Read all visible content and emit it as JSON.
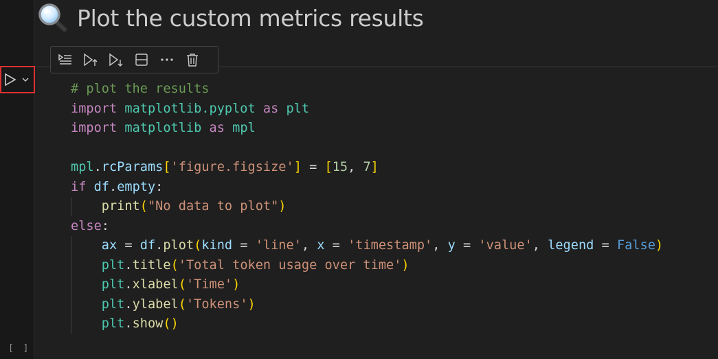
{
  "heading": {
    "icon": "magnifier-icon",
    "title": "Plot the custom metrics results"
  },
  "toolbar": {
    "items": [
      {
        "name": "run-by-line-icon"
      },
      {
        "name": "execute-above-icon"
      },
      {
        "name": "execute-below-icon"
      },
      {
        "name": "split-cell-icon"
      },
      {
        "name": "more-actions-icon"
      },
      {
        "name": "delete-cell-icon"
      }
    ]
  },
  "cell": {
    "execution_count": "[ ]",
    "run_icon": "play-icon",
    "code_lines": [
      [
        {
          "t": "# plot the results",
          "c": "com"
        }
      ],
      [
        {
          "t": "import",
          "c": "kw"
        },
        {
          "t": " ",
          "c": "def"
        },
        {
          "t": "matplotlib.pyplot",
          "c": "mod"
        },
        {
          "t": " ",
          "c": "def"
        },
        {
          "t": "as",
          "c": "kw"
        },
        {
          "t": " ",
          "c": "def"
        },
        {
          "t": "plt",
          "c": "mod"
        }
      ],
      [
        {
          "t": "import",
          "c": "kw"
        },
        {
          "t": " ",
          "c": "def"
        },
        {
          "t": "matplotlib",
          "c": "mod"
        },
        {
          "t": " ",
          "c": "def"
        },
        {
          "t": "as",
          "c": "kw"
        },
        {
          "t": " ",
          "c": "def"
        },
        {
          "t": "mpl",
          "c": "mod"
        }
      ],
      [],
      [
        {
          "t": "mpl",
          "c": "mod"
        },
        {
          "t": ".",
          "c": "def"
        },
        {
          "t": "rcParams",
          "c": "var"
        },
        {
          "t": "[",
          "c": "p1"
        },
        {
          "t": "'figure.figsize'",
          "c": "str"
        },
        {
          "t": "]",
          "c": "p1"
        },
        {
          "t": " = ",
          "c": "def"
        },
        {
          "t": "[",
          "c": "p1"
        },
        {
          "t": "15",
          "c": "num"
        },
        {
          "t": ", ",
          "c": "def"
        },
        {
          "t": "7",
          "c": "num"
        },
        {
          "t": "]",
          "c": "p1"
        }
      ],
      [
        {
          "t": "if",
          "c": "kw"
        },
        {
          "t": " ",
          "c": "def"
        },
        {
          "t": "df",
          "c": "var"
        },
        {
          "t": ".",
          "c": "def"
        },
        {
          "t": "empty",
          "c": "var"
        },
        {
          "t": ":",
          "c": "def"
        }
      ],
      [
        {
          "t": "    ",
          "c": "def"
        },
        {
          "t": "print",
          "c": "fn"
        },
        {
          "t": "(",
          "c": "p1"
        },
        {
          "t": "\"No data to plot\"",
          "c": "str"
        },
        {
          "t": ")",
          "c": "p1"
        }
      ],
      [
        {
          "t": "else",
          "c": "kw"
        },
        {
          "t": ":",
          "c": "def"
        }
      ],
      [
        {
          "t": "    ",
          "c": "def"
        },
        {
          "t": "ax",
          "c": "var"
        },
        {
          "t": " = ",
          "c": "def"
        },
        {
          "t": "df",
          "c": "var"
        },
        {
          "t": ".",
          "c": "def"
        },
        {
          "t": "plot",
          "c": "fn"
        },
        {
          "t": "(",
          "c": "p1"
        },
        {
          "t": "kind",
          "c": "var"
        },
        {
          "t": " = ",
          "c": "def"
        },
        {
          "t": "'line'",
          "c": "str"
        },
        {
          "t": ", ",
          "c": "def"
        },
        {
          "t": "x",
          "c": "var"
        },
        {
          "t": " = ",
          "c": "def"
        },
        {
          "t": "'timestamp'",
          "c": "str"
        },
        {
          "t": ", ",
          "c": "def"
        },
        {
          "t": "y",
          "c": "var"
        },
        {
          "t": " = ",
          "c": "def"
        },
        {
          "t": "'value'",
          "c": "str"
        },
        {
          "t": ", ",
          "c": "def"
        },
        {
          "t": "legend",
          "c": "var"
        },
        {
          "t": " = ",
          "c": "def"
        },
        {
          "t": "False",
          "c": "blue"
        },
        {
          "t": ")",
          "c": "p1"
        }
      ],
      [
        {
          "t": "    ",
          "c": "def"
        },
        {
          "t": "plt",
          "c": "mod"
        },
        {
          "t": ".",
          "c": "def"
        },
        {
          "t": "title",
          "c": "fn"
        },
        {
          "t": "(",
          "c": "p1"
        },
        {
          "t": "'Total token usage over time'",
          "c": "str"
        },
        {
          "t": ")",
          "c": "p1"
        }
      ],
      [
        {
          "t": "    ",
          "c": "def"
        },
        {
          "t": "plt",
          "c": "mod"
        },
        {
          "t": ".",
          "c": "def"
        },
        {
          "t": "xlabel",
          "c": "fn"
        },
        {
          "t": "(",
          "c": "p1"
        },
        {
          "t": "'Time'",
          "c": "str"
        },
        {
          "t": ")",
          "c": "p1"
        }
      ],
      [
        {
          "t": "    ",
          "c": "def"
        },
        {
          "t": "plt",
          "c": "mod"
        },
        {
          "t": ".",
          "c": "def"
        },
        {
          "t": "ylabel",
          "c": "fn"
        },
        {
          "t": "(",
          "c": "p1"
        },
        {
          "t": "'Tokens'",
          "c": "str"
        },
        {
          "t": ")",
          "c": "p1"
        }
      ],
      [
        {
          "t": "    ",
          "c": "def"
        },
        {
          "t": "plt",
          "c": "mod"
        },
        {
          "t": ".",
          "c": "def"
        },
        {
          "t": "show",
          "c": "fn"
        },
        {
          "t": "(",
          "c": "p1"
        },
        {
          "t": ")",
          "c": "p1"
        }
      ]
    ]
  },
  "colors": {
    "background": "#1f1f1f",
    "gutter": "#181818",
    "run_highlight": "#e03232",
    "comment": "#6a9955",
    "keyword": "#c586c0",
    "string": "#ce9178",
    "number": "#b5cea8",
    "function": "#dcdcaa",
    "module": "#4ec9b0",
    "variable": "#9cdcfe",
    "bracket": "#ffd700"
  }
}
